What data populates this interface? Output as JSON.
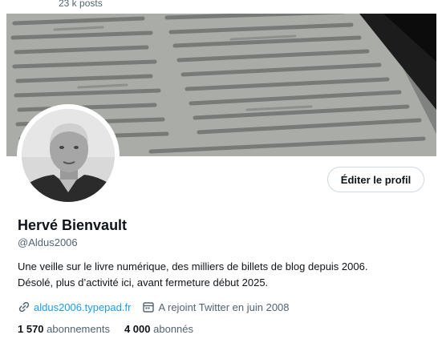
{
  "header": {
    "posts_count": "23 k posts"
  },
  "banner": {
    "description": ""
  },
  "profile": {
    "edit_button_label": "Éditer le profil",
    "display_name": "Hervé Bienvault",
    "handle": "@Aldus2006",
    "bio_lines": [
      "Une veille sur le livre numérique, des milliers de billets de blog depuis 2006.",
      "Désolé, plus d’activité ici, avant fermeture début 2025."
    ],
    "website": "aldus2006.typepad.fr",
    "joined": "A rejoint Twitter en juin 2008",
    "following_count": "1 570",
    "following_label": "abonnements",
    "followers_count": "4 000",
    "followers_label": "abonnés"
  },
  "colors": {
    "link": "#1d9bf0",
    "muted": "#536471",
    "text": "#0f1419"
  }
}
